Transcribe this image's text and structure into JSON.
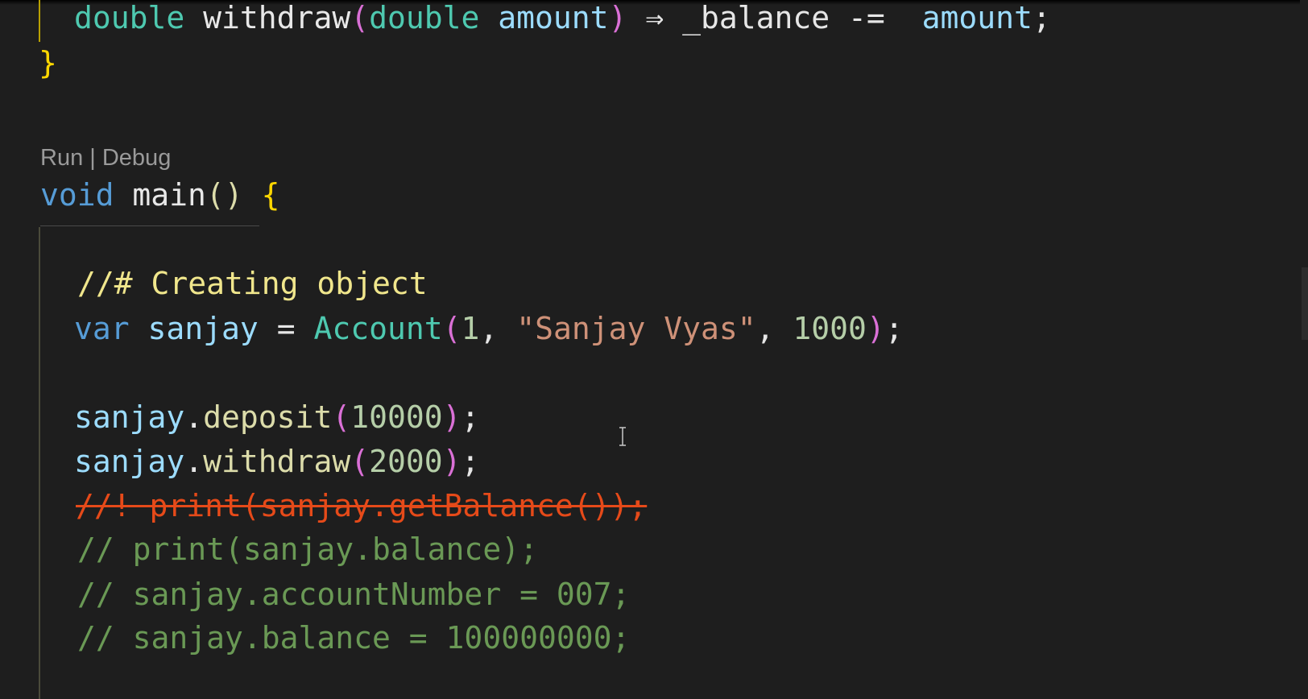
{
  "editor": {
    "codelens": {
      "run": "Run",
      "separator": " | ",
      "debug": "Debug"
    },
    "lines": {
      "l1": {
        "type1": "double",
        "name": "withdraw",
        "open_paren": "(",
        "type2": "double",
        "param": "amount",
        "close_paren": ")",
        "arrow": "⇒",
        "field": "_balance",
        "op": "-=",
        "rhs": "amount",
        "semi": ";"
      },
      "l2": {
        "close_brace": "}"
      },
      "l3": {
        "kw": "void",
        "name": "main",
        "parens": "()",
        "open_brace": "{"
      },
      "l4": {
        "comment": "//# Creating object"
      },
      "l5": {
        "kw": "var",
        "var": "sanjay",
        "eq": "=",
        "cls": "Account",
        "open_paren": "(",
        "arg1": "1",
        "comma1": ", ",
        "arg2": "\"Sanjay Vyas\"",
        "comma2": ", ",
        "arg3": "1000",
        "close_paren": ")",
        "semi": ";"
      },
      "l6": {
        "obj": "sanjay",
        "dot": ".",
        "method": "deposit",
        "open_paren": "(",
        "arg": "10000",
        "close_paren": ")",
        "semi": ";"
      },
      "l7": {
        "obj": "sanjay",
        "dot": ".",
        "method": "withdraw",
        "open_paren": "(",
        "arg": "2000",
        "close_paren": ")",
        "semi": ";"
      },
      "l8": {
        "comment": "//! print(sanjay.getBalance());"
      },
      "l9": {
        "comment": "// print(sanjay.balance);"
      },
      "l10": {
        "comment": "// sanjay.accountNumber = 007;"
      },
      "l11": {
        "comment": "// sanjay.balance = 100000000;"
      }
    }
  },
  "colors": {
    "background": "#1e1e1e",
    "keyword": "#569cd6",
    "type": "#4ec9b0",
    "function": "#dcdcaa",
    "number": "#b5cea8",
    "string": "#ce9178",
    "comment": "#6a9955",
    "highlight_comment": "#f0e68c",
    "alert_comment": "#e64a19",
    "bracket_gold": "#ffd700",
    "bracket_purple": "#da70d6"
  },
  "icons": {
    "mouse_cursor": "i-beam-cursor-icon"
  }
}
